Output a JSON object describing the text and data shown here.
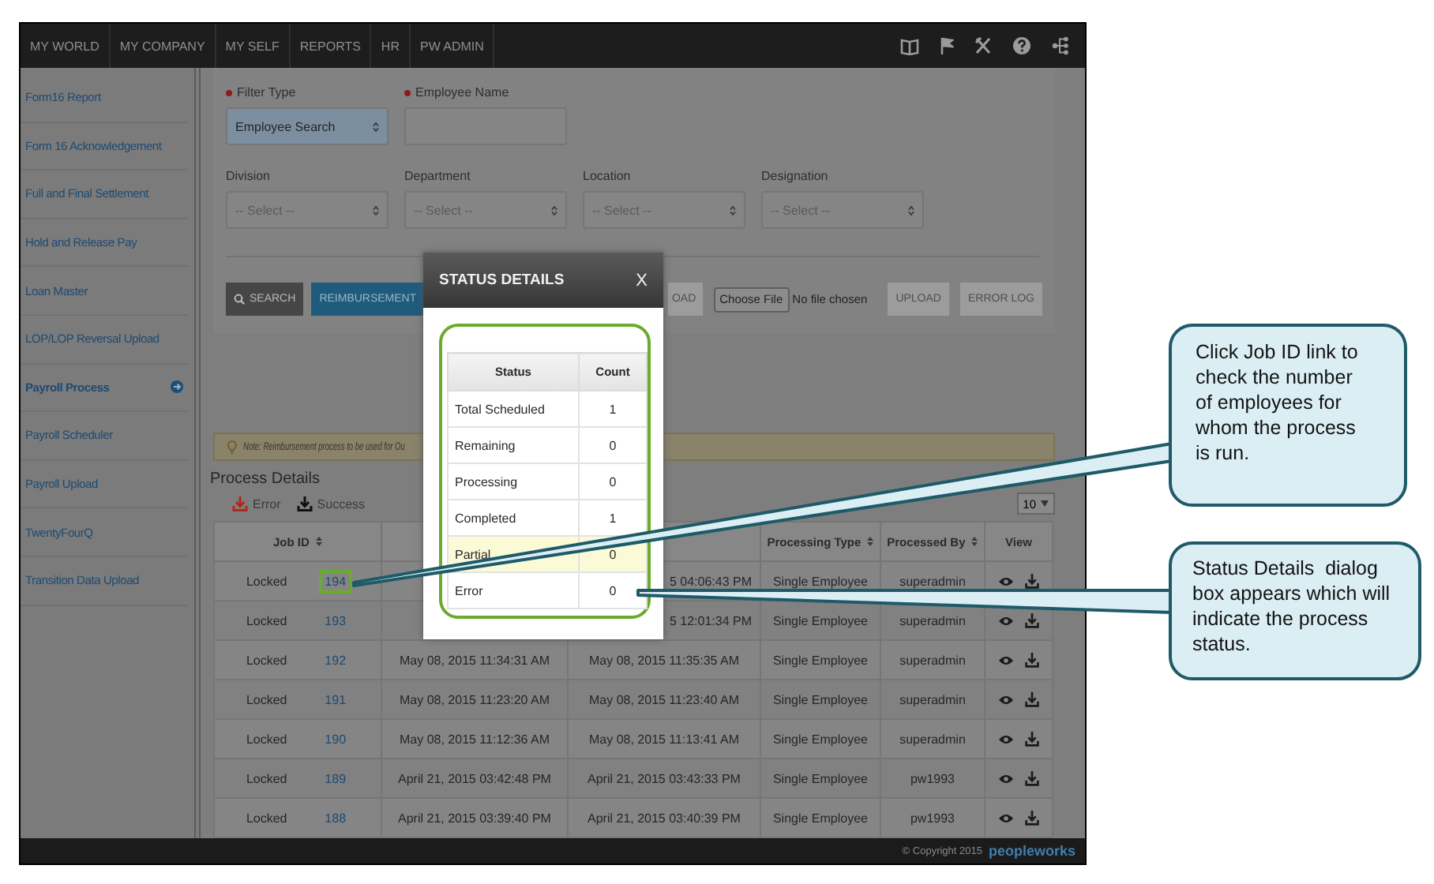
{
  "nav": {
    "items": [
      "MY WORLD",
      "MY COMPANY",
      "MY SELF",
      "REPORTS",
      "HR",
      "PW ADMIN"
    ]
  },
  "sidebar": {
    "items": [
      {
        "label": "Form16 Report",
        "selected": false
      },
      {
        "label": "Form 16 Acknowledgement",
        "selected": false
      },
      {
        "label": "Full and Final Settlement",
        "selected": false
      },
      {
        "label": "Hold and Release Pay",
        "selected": false
      },
      {
        "label": "Loan Master",
        "selected": false
      },
      {
        "label": "LOP/LOP Reversal Upload",
        "selected": false
      },
      {
        "label": "Payroll Process",
        "selected": true
      },
      {
        "label": "Payroll Scheduler",
        "selected": false
      },
      {
        "label": "Payroll Upload",
        "selected": false
      },
      {
        "label": "TwentyFourQ",
        "selected": false
      },
      {
        "label": "Transition Data Upload",
        "selected": false
      }
    ]
  },
  "filters": {
    "rows": [
      {
        "fields": [
          {
            "label": "Filter Type",
            "required": true,
            "kind": "select",
            "value": "Employee Search"
          },
          {
            "label": "Employee Name",
            "required": true,
            "kind": "input"
          }
        ]
      },
      {
        "fields": [
          {
            "label": "Division",
            "required": false,
            "kind": "select",
            "placeholder": "-- Select --"
          },
          {
            "label": "Department",
            "required": false,
            "kind": "select",
            "placeholder": "-- Select --"
          },
          {
            "label": "Location",
            "required": false,
            "kind": "select",
            "placeholder": "-- Select --"
          },
          {
            "label": "Designation",
            "required": false,
            "kind": "select",
            "placeholder": "-- Select --"
          }
        ]
      }
    ]
  },
  "actions": {
    "buttons": [
      {
        "label": "SEARCH",
        "kind": "search"
      },
      {
        "label": "REIMBURSEMENT",
        "kind": "primary"
      }
    ]
  },
  "upload": {
    "partial_button": "OAD",
    "file_button": "Choose File",
    "file_status": "No file chosen",
    "buttons": [
      {
        "label": "UPLOAD",
        "disabled": true
      },
      {
        "label": "ERROR LOG",
        "disabled": true
      }
    ]
  },
  "note": "Note: Reimbursement process to be used for Ou",
  "process_details": {
    "title": "Process Details",
    "downloads": [
      {
        "label": "Error",
        "kind": "error"
      },
      {
        "label": "Success",
        "kind": "success"
      }
    ],
    "page_size": "10",
    "columns": [
      {
        "label": "Job ID",
        "sortable": true
      },
      {},
      {},
      {
        "label": "Processing Type",
        "sortable": true
      },
      {
        "label": "Processed By",
        "sortable": true
      },
      {
        "label": "View",
        "sortable": false
      }
    ],
    "rows": [
      {
        "status": "Locked",
        "job_id": "194",
        "highlighted": true,
        "end": "5 04:06:43 PM",
        "type": "Single Employee",
        "by": "superadmin"
      },
      {
        "status": "Locked",
        "job_id": "193",
        "highlighted": false,
        "end": "5 12:01:34 PM",
        "type": "Single Employee",
        "by": "superadmin"
      },
      {
        "status": "Locked",
        "job_id": "192",
        "highlighted": false,
        "start": "May 08, 2015 11:34:31 AM",
        "end": "May 08, 2015 11:35:35 AM",
        "type": "Single Employee",
        "by": "superadmin"
      },
      {
        "status": "Locked",
        "job_id": "191",
        "highlighted": false,
        "start": "May 08, 2015 11:23:20 AM",
        "end": "May 08, 2015 11:23:40 AM",
        "type": "Single Employee",
        "by": "superadmin"
      },
      {
        "status": "Locked",
        "job_id": "190",
        "highlighted": false,
        "start": "May 08, 2015 11:12:36 AM",
        "end": "May 08, 2015 11:13:41 AM",
        "type": "Single Employee",
        "by": "superadmin"
      },
      {
        "status": "Locked",
        "job_id": "189",
        "highlighted": false,
        "start": "April 21, 2015 03:42:48 PM",
        "end": "April 21, 2015 03:43:33 PM",
        "type": "Single Employee",
        "by": "pw1993"
      },
      {
        "status": "Locked",
        "job_id": "188",
        "highlighted": false,
        "start": "April 21, 2015 03:39:40 PM",
        "end": "April 21, 2015 03:40:39 PM",
        "type": "Single Employee",
        "by": "pw1993"
      }
    ]
  },
  "status_dialog": {
    "title": "STATUS DETAILS",
    "close": "X",
    "columns": [
      "Status",
      "Count"
    ],
    "rows": [
      {
        "status": "Total Scheduled",
        "count": "1",
        "highlighted": false
      },
      {
        "status": "Remaining",
        "count": "0",
        "highlighted": false
      },
      {
        "status": "Processing",
        "count": "0",
        "highlighted": false
      },
      {
        "status": "Completed",
        "count": "1",
        "highlighted": false
      },
      {
        "status": "Partial",
        "count": "0",
        "highlighted": true
      },
      {
        "status": "Error",
        "count": "0",
        "highlighted": false
      }
    ]
  },
  "footer": {
    "copyright": "© Copyright 2015",
    "logo": "peopleworks"
  },
  "callouts": [
    {
      "text": "Click Job ID link to check the number of employees for whom the process is run."
    },
    {
      "text": "Status Details  dialog box appears which will indicate the process status."
    }
  ]
}
